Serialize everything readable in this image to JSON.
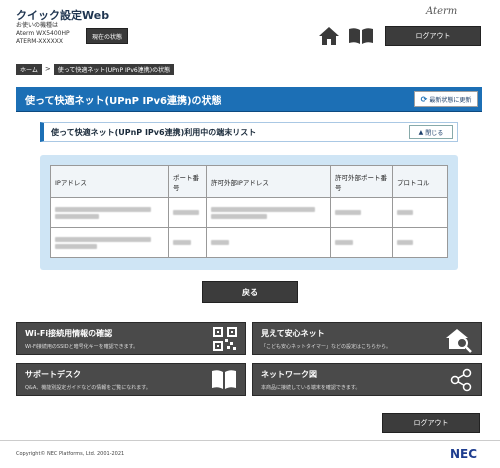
{
  "header": {
    "app_title": "クイック設定Web",
    "model_label": "お使いの機種は",
    "model_1": "Aterm WX5400HP",
    "model_2": "ATERM-XXXXXX",
    "status_button": "現在の状態",
    "brand": "Aterm",
    "logout": "ログアウト"
  },
  "breadcrumb": {
    "home": "ホーム",
    "separator": ">",
    "current": "使って快適ネット(UPnP IPv6連携)の状態"
  },
  "page": {
    "title": "使って快適ネット(UPnP IPv6連携)の状態",
    "refresh": "最新状態に更新"
  },
  "section": {
    "title": "使って快適ネット(UPnP IPv6連携)利用中の端末リスト",
    "close": "閉じる"
  },
  "table": {
    "headers": [
      "IPアドレス",
      "ポート番号",
      "許可外部IPアドレス",
      "許可外部ポート番号",
      "プロトコル"
    ],
    "rows": [
      [
        "",
        "",
        "",
        "",
        ""
      ],
      [
        "",
        "",
        "",
        "",
        ""
      ]
    ]
  },
  "back_button": "戻る",
  "cards": {
    "wifi": {
      "title": "Wi-Fi接続用情報の確認",
      "desc": "Wi-Fi接続用のSSIDと暗号化キーを確認できます。"
    },
    "safe": {
      "title": "見えて安心ネット",
      "desc": "「こども安心ネットタイマー」などの設定はこちらから。"
    },
    "support": {
      "title": "サポートデスク",
      "desc": "Q&A、機能別設定ガイドなどの情報をご覧になれます。"
    },
    "network": {
      "title": "ネットワーク図",
      "desc": "本商品に接続している端末を確認できます。"
    }
  },
  "footer": {
    "logout": "ログアウト",
    "copyright": "Copyright© NEC Platforms, Ltd. 2001-2021",
    "nec": "NEC"
  },
  "colors": {
    "accent_blue": "#1c6fb5",
    "table_bg": "#cfe5f5",
    "dark_button": "#3c3c3c"
  }
}
